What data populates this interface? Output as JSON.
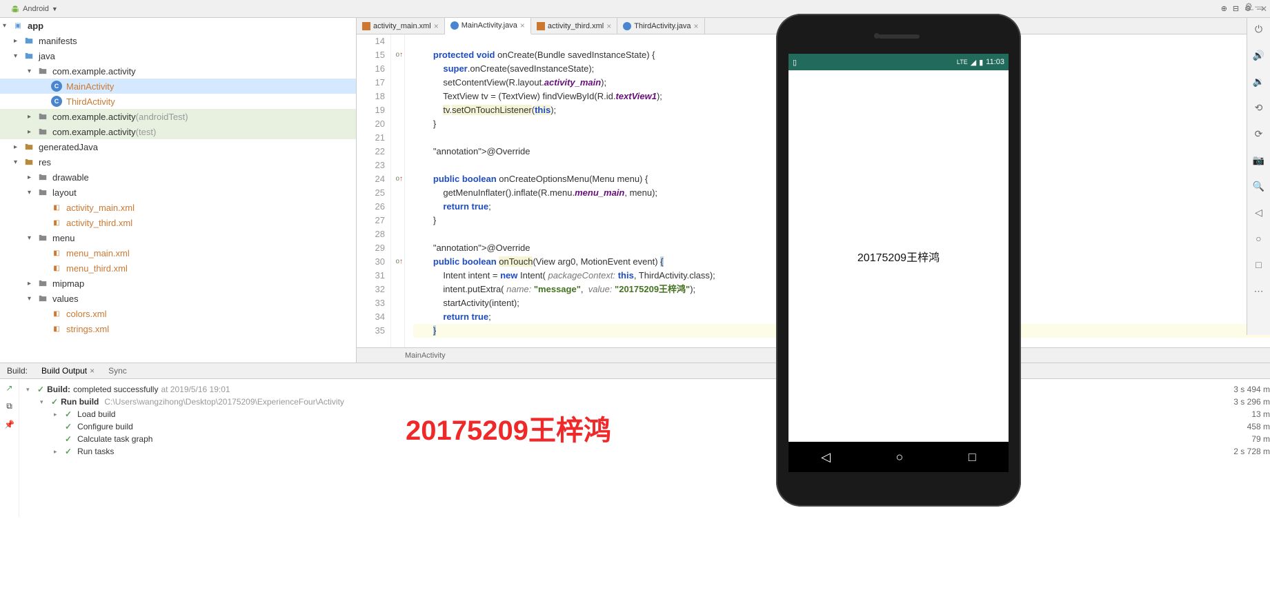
{
  "toolbar": {
    "view": "Android"
  },
  "tree": {
    "root": "app",
    "items": [
      {
        "d": 1,
        "toggle": "▸",
        "cls": "folder-icon blue",
        "label": "manifests",
        "hl": false
      },
      {
        "d": 1,
        "toggle": "▾",
        "cls": "folder-icon blue",
        "label": "java",
        "hl": false
      },
      {
        "d": 2,
        "toggle": "▾",
        "cls": "folder-icon",
        "label": "com.example.activity",
        "hl": false
      },
      {
        "d": 3,
        "toggle": "",
        "cls": "file-icon java",
        "glyph": "C",
        "label": "MainActivity",
        "selected": true,
        "hl": true
      },
      {
        "d": 3,
        "toggle": "",
        "cls": "file-icon java",
        "glyph": "C",
        "label": "ThirdActivity",
        "hl": true
      },
      {
        "d": 2,
        "toggle": "▸",
        "cls": "folder-icon",
        "label": "com.example.activity",
        "suffix": " (androidTest)",
        "highlighted": true
      },
      {
        "d": 2,
        "toggle": "▸",
        "cls": "folder-icon",
        "label": "com.example.activity",
        "suffix": " (test)",
        "highlighted": true
      },
      {
        "d": 1,
        "toggle": "▸",
        "cls": "folder-icon yellow",
        "label": "generatedJava",
        "hl": false
      },
      {
        "d": 1,
        "toggle": "▾",
        "cls": "folder-icon yellow",
        "label": "res",
        "hl": false
      },
      {
        "d": 2,
        "toggle": "▸",
        "cls": "folder-icon",
        "label": "drawable",
        "hl": false
      },
      {
        "d": 2,
        "toggle": "▾",
        "cls": "folder-icon",
        "label": "layout",
        "hl": false
      },
      {
        "d": 3,
        "toggle": "",
        "cls": "file-icon xml",
        "glyph": "◧",
        "label": "activity_main.xml",
        "hl": true
      },
      {
        "d": 3,
        "toggle": "",
        "cls": "file-icon xml",
        "glyph": "◧",
        "label": "activity_third.xml",
        "hl": true
      },
      {
        "d": 2,
        "toggle": "▾",
        "cls": "folder-icon",
        "label": "menu",
        "hl": false
      },
      {
        "d": 3,
        "toggle": "",
        "cls": "file-icon xml",
        "glyph": "◧",
        "label": "menu_main.xml",
        "hl": true
      },
      {
        "d": 3,
        "toggle": "",
        "cls": "file-icon xml",
        "glyph": "◧",
        "label": "menu_third.xml",
        "hl": true
      },
      {
        "d": 2,
        "toggle": "▸",
        "cls": "folder-icon",
        "label": "mipmap",
        "hl": false
      },
      {
        "d": 2,
        "toggle": "▾",
        "cls": "folder-icon",
        "label": "values",
        "hl": false
      },
      {
        "d": 3,
        "toggle": "",
        "cls": "file-icon xml",
        "glyph": "◧",
        "label": "colors.xml",
        "hl": true
      },
      {
        "d": 3,
        "toggle": "",
        "cls": "file-icon xml",
        "glyph": "◧",
        "label": "strings.xml",
        "hl": true
      }
    ]
  },
  "tabs": [
    {
      "icon": "xml",
      "label": "activity_main.xml",
      "active": false
    },
    {
      "icon": "java",
      "label": "MainActivity.java",
      "active": true
    },
    {
      "icon": "xml",
      "label": "activity_third.xml",
      "active": false
    },
    {
      "icon": "java",
      "label": "ThirdActivity.java",
      "active": false
    }
  ],
  "code": {
    "startLine": 14,
    "lines": [
      "",
      "        protected void onCreate(Bundle savedInstanceState) {",
      "            super.onCreate(savedInstanceState);",
      "            setContentView(R.layout.activity_main);",
      "            TextView tv = (TextView) findViewById(R.id.textView1);",
      "            tv.setOnTouchListener(this);",
      "        }",
      "",
      "        @Override",
      "",
      "        public boolean onCreateOptionsMenu(Menu menu) {",
      "            getMenuInflater().inflate(R.menu.menu_main, menu);",
      "            return true;",
      "        }",
      "",
      "        @Override",
      "        public boolean onTouch(View arg0, MotionEvent event) {",
      "            Intent intent = new Intent( packageContext: this, ThirdActivity.class);",
      "            intent.putExtra( name: \"message\",  value: \"20175209王梓鸿\");",
      "            startActivity(intent);",
      "            return true;",
      "        }"
    ],
    "breadcrumb": "MainActivity"
  },
  "bottomPanel": {
    "label": "Build:",
    "tabs": [
      "Build Output",
      "Sync"
    ],
    "activeTab": "Build Output",
    "lines": [
      {
        "d": 0,
        "icon": "✓",
        "bold": "Build: ",
        "text": "completed successfully",
        "muted": " at 2019/5/16 19:01"
      },
      {
        "d": 1,
        "icon": "✓",
        "bold": "Run build ",
        "text": "",
        "muted": "C:\\Users\\wangzihong\\Desktop\\20175209\\ExperienceFour\\Activity"
      },
      {
        "d": 2,
        "icon": "✓",
        "bold": "",
        "text": "Load build",
        "muted": ""
      },
      {
        "d": 2,
        "icon": "✓",
        "bold": "",
        "text": "Configure build",
        "muted": ""
      },
      {
        "d": 2,
        "icon": "✓",
        "bold": "",
        "text": "Calculate task graph",
        "muted": ""
      },
      {
        "d": 2,
        "icon": "✓",
        "bold": "",
        "text": "Run tasks",
        "muted": ""
      }
    ],
    "times": [
      "3 s 494 m",
      "3 s 296 m",
      "13 m",
      "458 m",
      "79 m",
      "2 s 728 m"
    ],
    "watermark": "20175209王梓鸿"
  },
  "emulator": {
    "time": "11:03",
    "net": "LTE",
    "content": "20175209王梓鸿"
  }
}
